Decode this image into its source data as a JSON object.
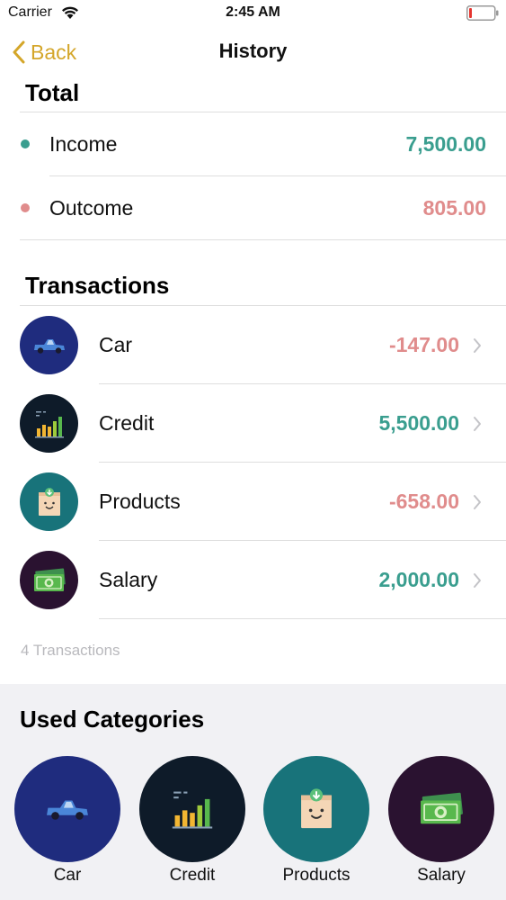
{
  "status_bar": {
    "carrier": "Carrier",
    "time": "2:45 AM"
  },
  "nav": {
    "back_label": "Back",
    "title": "History"
  },
  "totals": {
    "title": "Total",
    "income": {
      "label": "Income",
      "amount": "7,500.00"
    },
    "outcome": {
      "label": "Outcome",
      "amount": "805.00"
    }
  },
  "transactions": {
    "title": "Transactions",
    "items": [
      {
        "label": "Car",
        "amount": "-147.00",
        "icon": "car-icon"
      },
      {
        "label": "Credit",
        "amount": "5,500.00",
        "icon": "bar-chart-icon"
      },
      {
        "label": "Products",
        "amount": "-658.00",
        "icon": "shopping-bag-icon"
      },
      {
        "label": "Salary",
        "amount": "2,000.00",
        "icon": "money-icon"
      }
    ],
    "count_text": "4 Transactions"
  },
  "categories": {
    "title": "Used Categories",
    "items": [
      {
        "label": "Car",
        "icon": "car-icon"
      },
      {
        "label": "Credit",
        "icon": "bar-chart-icon"
      },
      {
        "label": "Products",
        "icon": "shopping-bag-icon"
      },
      {
        "label": "Salary",
        "icon": "money-icon"
      }
    ]
  },
  "colors": {
    "accent": "#d4a62a",
    "income": "#3a9e8f",
    "outcome": "#e08c8c",
    "car_bg": "#1f2c7e",
    "credit_bg": "#0e1b29",
    "products_bg": "#18737a",
    "salary_bg": "#2a1230"
  }
}
